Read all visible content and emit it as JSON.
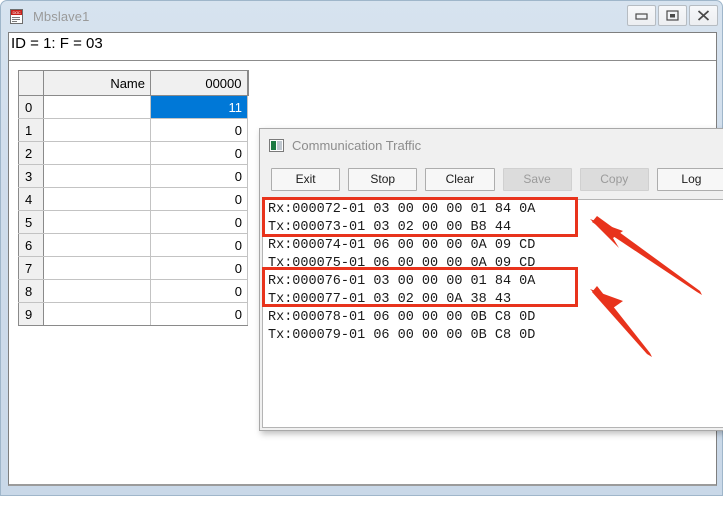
{
  "main_window": {
    "title": "Mbslave1",
    "icon": "document-icon",
    "icon_label": "DOC",
    "status_line": "ID = 1: F = 03",
    "controls": [
      {
        "name": "minimize",
        "label": "Minimize"
      },
      {
        "name": "maximize",
        "label": "Maximize"
      },
      {
        "name": "close",
        "label": "Close"
      }
    ],
    "grid": {
      "headers": [
        "",
        "Name",
        "00000"
      ],
      "rows": [
        {
          "index": "0",
          "name": "",
          "value": "11",
          "selected": true
        },
        {
          "index": "1",
          "name": "",
          "value": "0",
          "selected": false
        },
        {
          "index": "2",
          "name": "",
          "value": "0",
          "selected": false
        },
        {
          "index": "3",
          "name": "",
          "value": "0",
          "selected": false
        },
        {
          "index": "4",
          "name": "",
          "value": "0",
          "selected": false
        },
        {
          "index": "5",
          "name": "",
          "value": "0",
          "selected": false
        },
        {
          "index": "6",
          "name": "",
          "value": "0",
          "selected": false
        },
        {
          "index": "7",
          "name": "",
          "value": "0",
          "selected": false
        },
        {
          "index": "8",
          "name": "",
          "value": "0",
          "selected": false
        },
        {
          "index": "9",
          "name": "",
          "value": "0",
          "selected": false
        }
      ]
    }
  },
  "comm_window": {
    "title": "Communication Traffic",
    "icon": "application-icon",
    "toolbar": [
      {
        "label": "Exit",
        "disabled": false
      },
      {
        "label": "Stop",
        "disabled": false
      },
      {
        "label": "Clear",
        "disabled": false
      },
      {
        "label": "Save",
        "disabled": true
      },
      {
        "label": "Copy",
        "disabled": true
      },
      {
        "label": "Log",
        "disabled": false
      }
    ],
    "log_lines": [
      "Rx:000072-01 03 00 00 00 01 84 0A",
      "Tx:000073-01 03 02 00 00 B8 44",
      "Rx:000074-01 06 00 00 00 0A 09 CD",
      "Tx:000075-01 06 00 00 00 0A 09 CD",
      "Rx:000076-01 03 00 00 00 01 84 0A",
      "Tx:000077-01 03 02 00 0A 38 43",
      "Rx:000078-01 06 00 00 00 0B C8 0D",
      "Tx:000079-01 06 00 00 00 0B C8 0D"
    ]
  },
  "annotations": {
    "highlight_color": "#e8331c",
    "boxes": [
      {
        "name": "highlight-box-1",
        "target_lines": [
          0,
          1
        ]
      },
      {
        "name": "highlight-box-2",
        "target_lines": [
          4,
          5
        ]
      }
    ],
    "arrows": [
      {
        "name": "arrow-1",
        "direction": "up-left"
      },
      {
        "name": "arrow-2",
        "direction": "up-left"
      }
    ]
  },
  "colors": {
    "selection": "#0078d7",
    "annotation": "#e8331c",
    "titlebar_text": "#9a9a9a"
  }
}
